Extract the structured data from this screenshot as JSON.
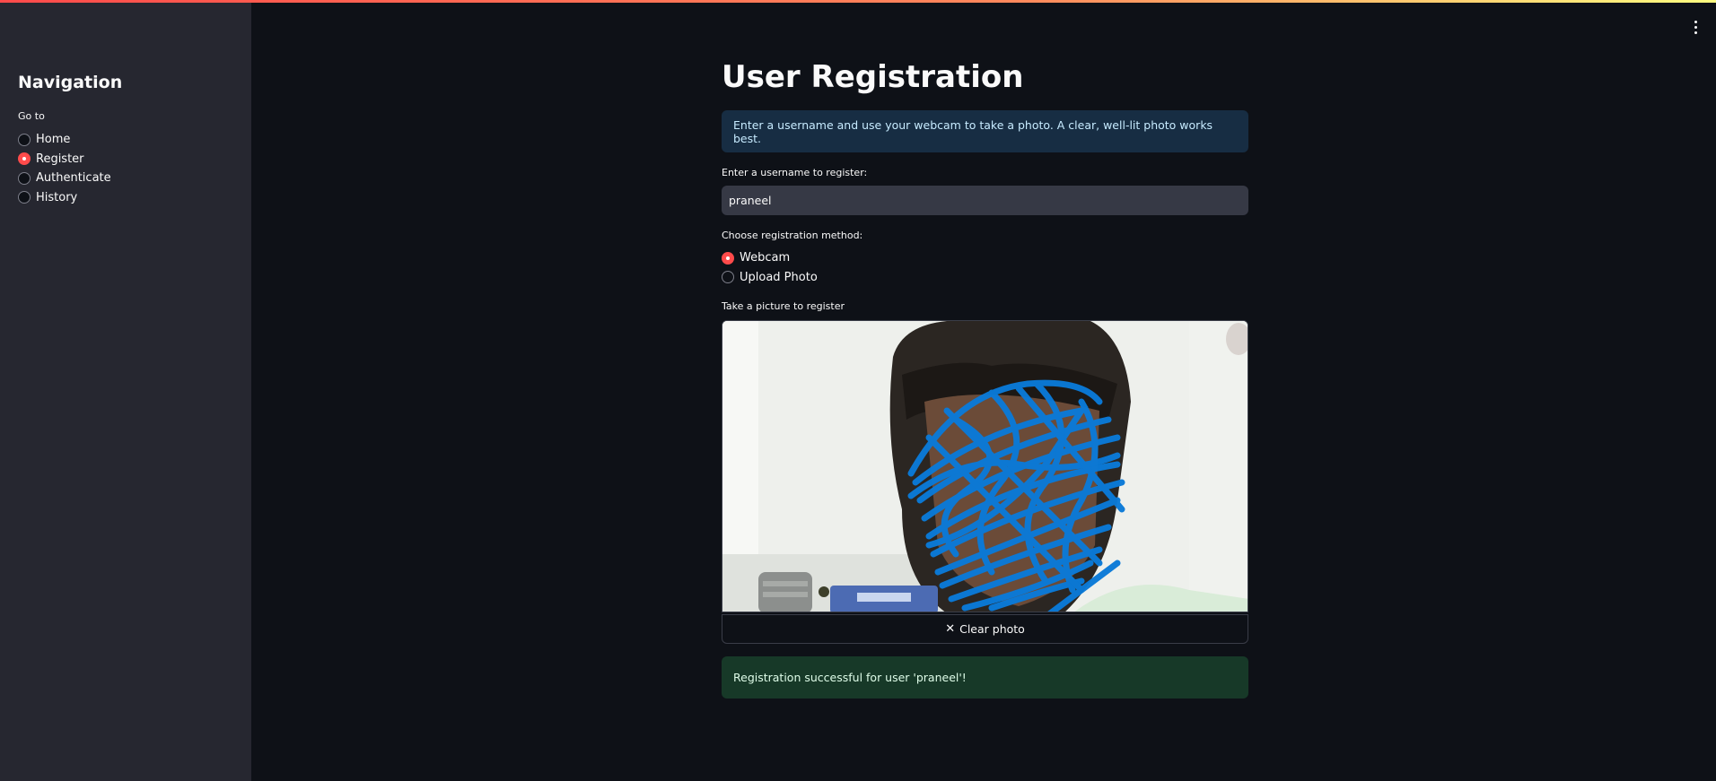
{
  "sidebar": {
    "title": "Navigation",
    "goto_label": "Go to",
    "items": [
      {
        "label": "Home",
        "selected": false
      },
      {
        "label": "Register",
        "selected": true
      },
      {
        "label": "Authenticate",
        "selected": false
      },
      {
        "label": "History",
        "selected": false
      }
    ]
  },
  "main": {
    "title": "User Registration",
    "info": "Enter a username and use your webcam to take a photo. A clear, well-lit photo works best.",
    "username_label": "Enter a username to register:",
    "username_value": "praneel",
    "method_label": "Choose registration method:",
    "methods": [
      {
        "label": "Webcam",
        "selected": true
      },
      {
        "label": "Upload Photo",
        "selected": false
      }
    ],
    "camera_label": "Take a picture to register",
    "clear_button": "Clear photo",
    "success": "Registration successful for user 'praneel'!"
  },
  "colors": {
    "accent": "#ff4b4b",
    "sidebar_bg": "#262730",
    "main_bg": "#0e1117",
    "info_bg": "#172d43",
    "success_bg": "#173928",
    "scribble": "#0a7ad8"
  }
}
